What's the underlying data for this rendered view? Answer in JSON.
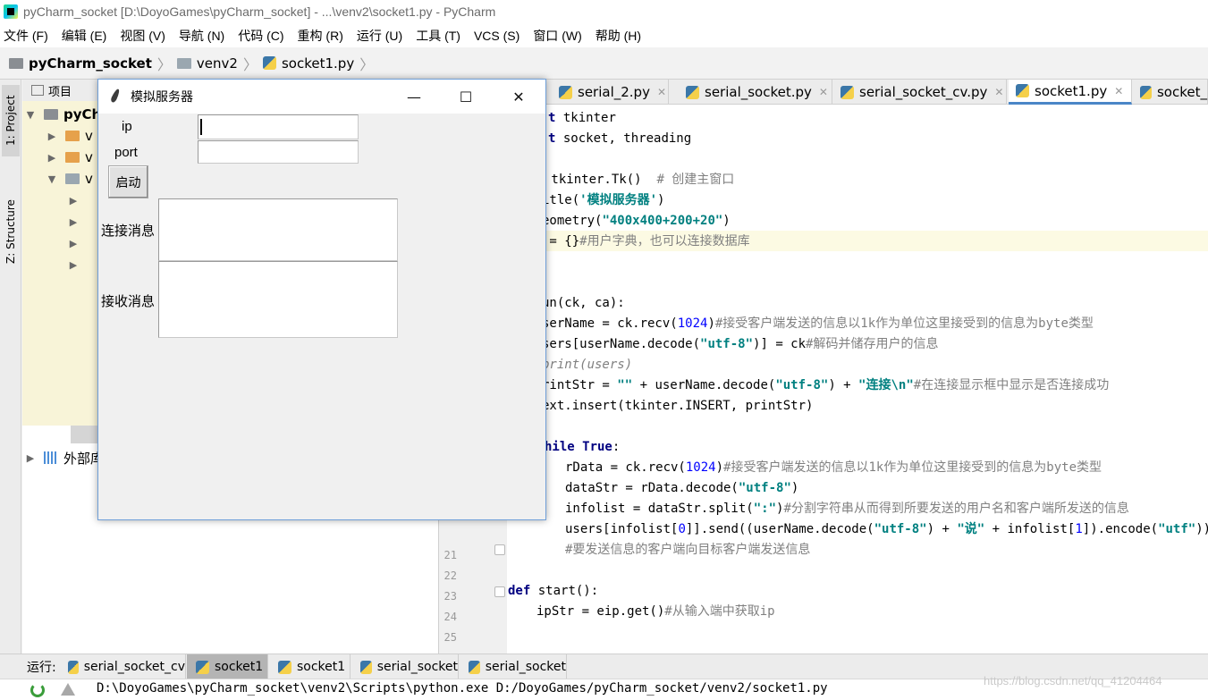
{
  "window": {
    "title": "pyCharm_socket [D:\\DoyoGames\\pyCharm_socket] - ...\\venv2\\socket1.py - PyCharm"
  },
  "menu": [
    "文件 (F)",
    "编辑 (E)",
    "视图 (V)",
    "导航 (N)",
    "代码 (C)",
    "重构 (R)",
    "运行 (U)",
    "工具 (T)",
    "VCS (S)",
    "窗口 (W)",
    "帮助 (H)"
  ],
  "breadcrumb": {
    "project": "pyCharm_socket",
    "folder": "venv2",
    "file": "socket1.py"
  },
  "sidebar": {
    "project_tab": "1: Project",
    "structure_tab": "Z: Structure"
  },
  "project_panel": {
    "header": "项目",
    "root": "pyCh",
    "rows": [
      "v",
      "v",
      "v"
    ],
    "external": "外部库"
  },
  "editor_tabs": [
    {
      "label": "serial_2.py",
      "active": false
    },
    {
      "label": "serial_socket.py",
      "active": false
    },
    {
      "label": "serial_socket_cv.py",
      "active": false
    },
    {
      "label": "socket1.py",
      "active": true
    },
    {
      "label": "socket_",
      "active": false
    }
  ],
  "line_numbers": [
    "21",
    "22",
    "23",
    "24",
    "25"
  ],
  "code": {
    "l1a": "t",
    "l1b": " tkinter",
    "l2a": "t",
    "l2b": " socket, threading",
    "l3a": " tkinter.Tk()  ",
    "l3b": "# 创建主窗口",
    "l4a": "itle(",
    "l4b": "'模拟服务器'",
    "l4c": ")",
    "l5a": "eometry(",
    "l5b": "\"400x400+200+20\"",
    "l5c": ")",
    "l6a": " = {}",
    "l6b": "#用户字典，也可以连接数据库",
    "l7": "un(ck, ca):",
    "l8a": "serName = ck.recv(",
    "l8b": "1024",
    "l8c": ")",
    "l8d": "#接受客户端发送的信息以1k作为单位这里接受到的信息为byte类型",
    "l9a": "sers[userName.decode(",
    "l9b": "\"utf-8\"",
    "l9c": ")] = ck",
    "l9d": "#解码并储存用户的信息",
    "l10": "print(users)",
    "l11a": "rintStr = ",
    "l11b": "\"\"",
    "l11c": " + userName.decode(",
    "l11d": "\"utf-8\"",
    "l11e": ") + ",
    "l11f": "\"连接\\n\"",
    "l11g": "#在连接显示框中显示是否连接成功",
    "l12": "ext.insert(tkinter.INSERT, printStr)",
    "l13a": "hile True",
    "l13b": ":",
    "l14a": "rData = ck.recv(",
    "l14b": "1024",
    "l14c": ")",
    "l14d": "#接受客户端发送的信息以1k作为单位这里接受到的信息为byte类型",
    "l15a": "dataStr = rData.decode(",
    "l15b": "\"utf-8\"",
    "l15c": ")",
    "l16a": "infolist = dataStr.split(",
    "l16b": "\":\"",
    "l16c": ")",
    "l16d": "#分割字符串从而得到所要发送的用户名和客户端所发送的信息",
    "l17a": "users[infolist[",
    "l17b": "0",
    "l17c": "]].send((userName.decode(",
    "l17d": "\"utf-8\"",
    "l17e": ") + ",
    "l17f": "\"说\"",
    "l17g": " + infolist[",
    "l17h": "1",
    "l17i": "]).encode(",
    "l17j": "\"utf\"",
    "l17k": "))",
    "l18": "#要发送信息的客户端向目标客户端发送信息",
    "l19a": "def",
    "l19b": " start():",
    "l20a": "ipStr = eip.get()",
    "l20b": "#从输入端中获取ip"
  },
  "tk_window": {
    "title": "模拟服务器",
    "ip_label": "ip",
    "port_label": "port",
    "start_button": "启动",
    "connect_label": "连接消息",
    "receive_label": "接收消息",
    "minimize": "—",
    "maximize": "☐",
    "close": "✕"
  },
  "run_bar": {
    "label": "运行:",
    "tabs": [
      {
        "label": "serial_socket_cv",
        "active": false
      },
      {
        "label": "socket1",
        "active": true
      },
      {
        "label": "socket1",
        "active": false
      },
      {
        "label": "serial_socket",
        "active": false
      },
      {
        "label": "serial_socket",
        "active": false
      }
    ]
  },
  "console": {
    "command": "D:\\DoyoGames\\pyCharm_socket\\venv2\\Scripts\\python.exe D:/DoyoGames/pyCharm_socket/venv2/socket1.py"
  },
  "watermark": "https://blog.csdn.net/qq_41204464"
}
